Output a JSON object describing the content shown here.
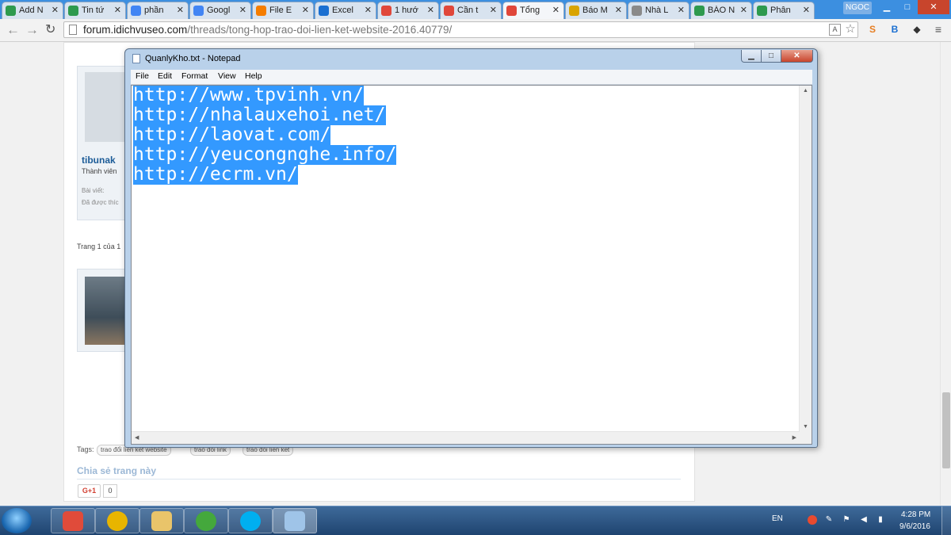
{
  "browser": {
    "tabs": [
      {
        "label": "Add N",
        "favicon": "cloud-icon",
        "color": "#2e9a4e"
      },
      {
        "label": "Tin tứ",
        "favicon": "cloud-icon",
        "color": "#2e9a4e"
      },
      {
        "label": "phần",
        "favicon": "google-icon",
        "color": "#4285f4"
      },
      {
        "label": "Googl",
        "favicon": "google-icon",
        "color": "#4285f4"
      },
      {
        "label": "File E",
        "favicon": "blogger-icon",
        "color": "#f57d00"
      },
      {
        "label": "Excel",
        "favicon": "a-icon",
        "color": "#1a6fd1"
      },
      {
        "label": "1 hướ",
        "favicon": "idvs-icon",
        "color": "#e0473a"
      },
      {
        "label": "Cần t",
        "favicon": "idvs-icon",
        "color": "#e0473a"
      },
      {
        "label": "Tổng",
        "favicon": "idvs-icon",
        "color": "#e0473a"
      },
      {
        "label": "Báo M",
        "favicon": "tag-icon",
        "color": "#d9a400"
      },
      {
        "label": "Nhà L",
        "favicon": "page-icon",
        "color": "#8a8a8a"
      },
      {
        "label": "BÁO N",
        "favicon": "c-icon",
        "color": "#2e9a4e"
      },
      {
        "label": "Phân",
        "favicon": "cloud-icon",
        "color": "#2e9a4e"
      }
    ],
    "user": "NGOC",
    "url_domain": "forum.idichvuseo.com",
    "url_path": "/threads/tong-hop-trao-doi-lien-ket-website-2016.40779/"
  },
  "forum": {
    "username": "tibunak",
    "user_title": "Thành viên",
    "posts_label": "Bài viết:",
    "liked_label": "Đã được thíc",
    "page_info": "Trang 1 của 1",
    "tags_label": "Tags:",
    "tags": [
      "trao đổi liên kết website",
      "trao đổi link",
      "trao đổi liên kết"
    ],
    "share_title": "Chia sẻ trang này",
    "gplus_label": "G+1",
    "gplus_count": "0"
  },
  "notepad": {
    "title": "QuanlyKho.txt - Notepad",
    "menu": [
      "File",
      "Edit",
      "Format",
      "View",
      "Help"
    ],
    "lines": [
      "http://www.tpvinh.vn/",
      "http://nhalauxehoi.net/",
      "http://laovat.com/",
      "http://yeucongnghe.info/",
      "http://ecrm.vn/"
    ],
    "selection_color": "#3399ff"
  },
  "taskbar": {
    "apps": [
      {
        "name": "apps-icon",
        "color": "#e04b3a"
      },
      {
        "name": "chrome-icon",
        "color": "#e8b500"
      },
      {
        "name": "file-explorer-icon",
        "color": "#e9c46a"
      },
      {
        "name": "coccoc-icon",
        "color": "#44a83c"
      },
      {
        "name": "skype-icon",
        "color": "#00aff0"
      },
      {
        "name": "notepad-icon",
        "color": "#9fc4e8"
      }
    ],
    "language": "EN",
    "time": "4:28 PM",
    "date": "9/6/2016"
  }
}
